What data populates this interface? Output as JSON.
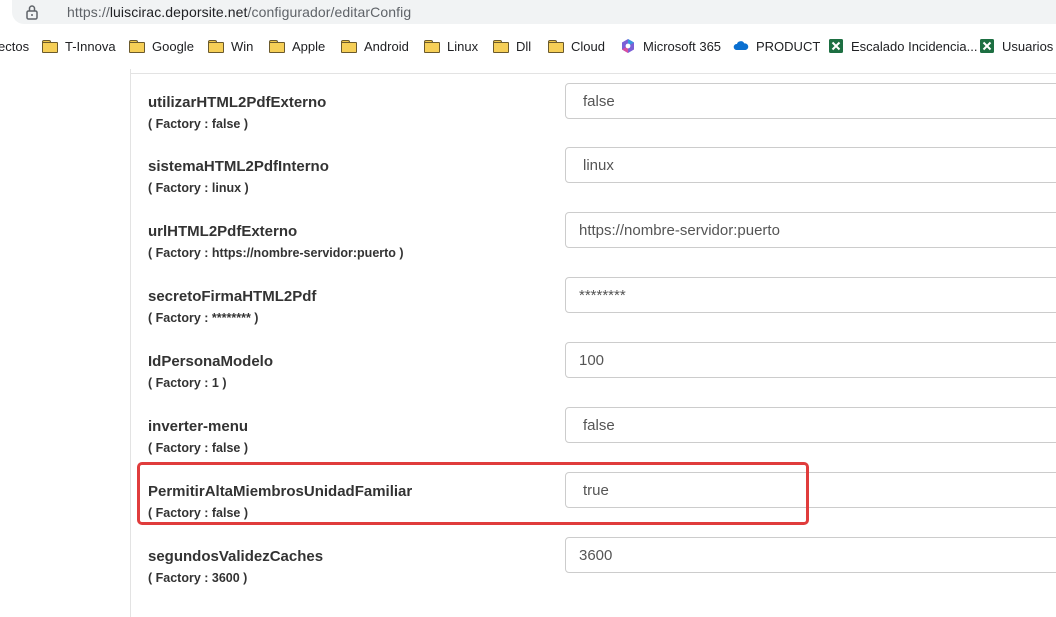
{
  "browser": {
    "url_scheme": "https://",
    "url_host": "luiscirac.deporsite.net",
    "url_path": "/configurador/editarConfig"
  },
  "bookmarks": [
    {
      "label": "ectos",
      "icon": "none"
    },
    {
      "label": "T-Innova",
      "icon": "folder-icon"
    },
    {
      "label": "Google",
      "icon": "folder-icon"
    },
    {
      "label": "Win",
      "icon": "folder-icon"
    },
    {
      "label": "Apple",
      "icon": "folder-icon"
    },
    {
      "label": "Android",
      "icon": "folder-icon"
    },
    {
      "label": "Linux",
      "icon": "folder-icon"
    },
    {
      "label": "Dll",
      "icon": "folder-icon"
    },
    {
      "label": "Cloud",
      "icon": "folder-icon"
    },
    {
      "label": "Microsoft 365",
      "icon": "microsoft365-icon"
    },
    {
      "label": "PRODUCT",
      "icon": "onedrive-icon"
    },
    {
      "label": "Escalado Incidencia...",
      "icon": "excel-icon"
    },
    {
      "label": "Usuarios A",
      "icon": "excel-icon"
    }
  ],
  "config": [
    {
      "name": "utilizarHTML2PdfExterno",
      "factory": "( Factory : false )",
      "value": "false"
    },
    {
      "name": "sistemaHTML2PdfInterno",
      "factory": "( Factory : linux )",
      "value": "linux"
    },
    {
      "name": "urlHTML2PdfExterno",
      "factory": "( Factory : https://nombre-servidor:puerto )",
      "value": "https://nombre-servidor:puerto"
    },
    {
      "name": "secretoFirmaHTML2Pdf",
      "factory": "( Factory : ******** )",
      "value": "********"
    },
    {
      "name": "IdPersonaModelo",
      "factory": "( Factory : 1 )",
      "value": "100"
    },
    {
      "name": "inverter-menu",
      "factory": "( Factory : false )",
      "value": "false"
    },
    {
      "name": "PermitirAltaMiembrosUnidadFamiliar",
      "factory": "( Factory : false )",
      "value": "true"
    },
    {
      "name": "segundosValidezCaches",
      "factory": "( Factory : 3600 )",
      "value": "3600"
    }
  ],
  "colors": {
    "highlight_border": "#e03c3c",
    "folder": "#f6cf57",
    "excel_green": "#1d6f42"
  }
}
